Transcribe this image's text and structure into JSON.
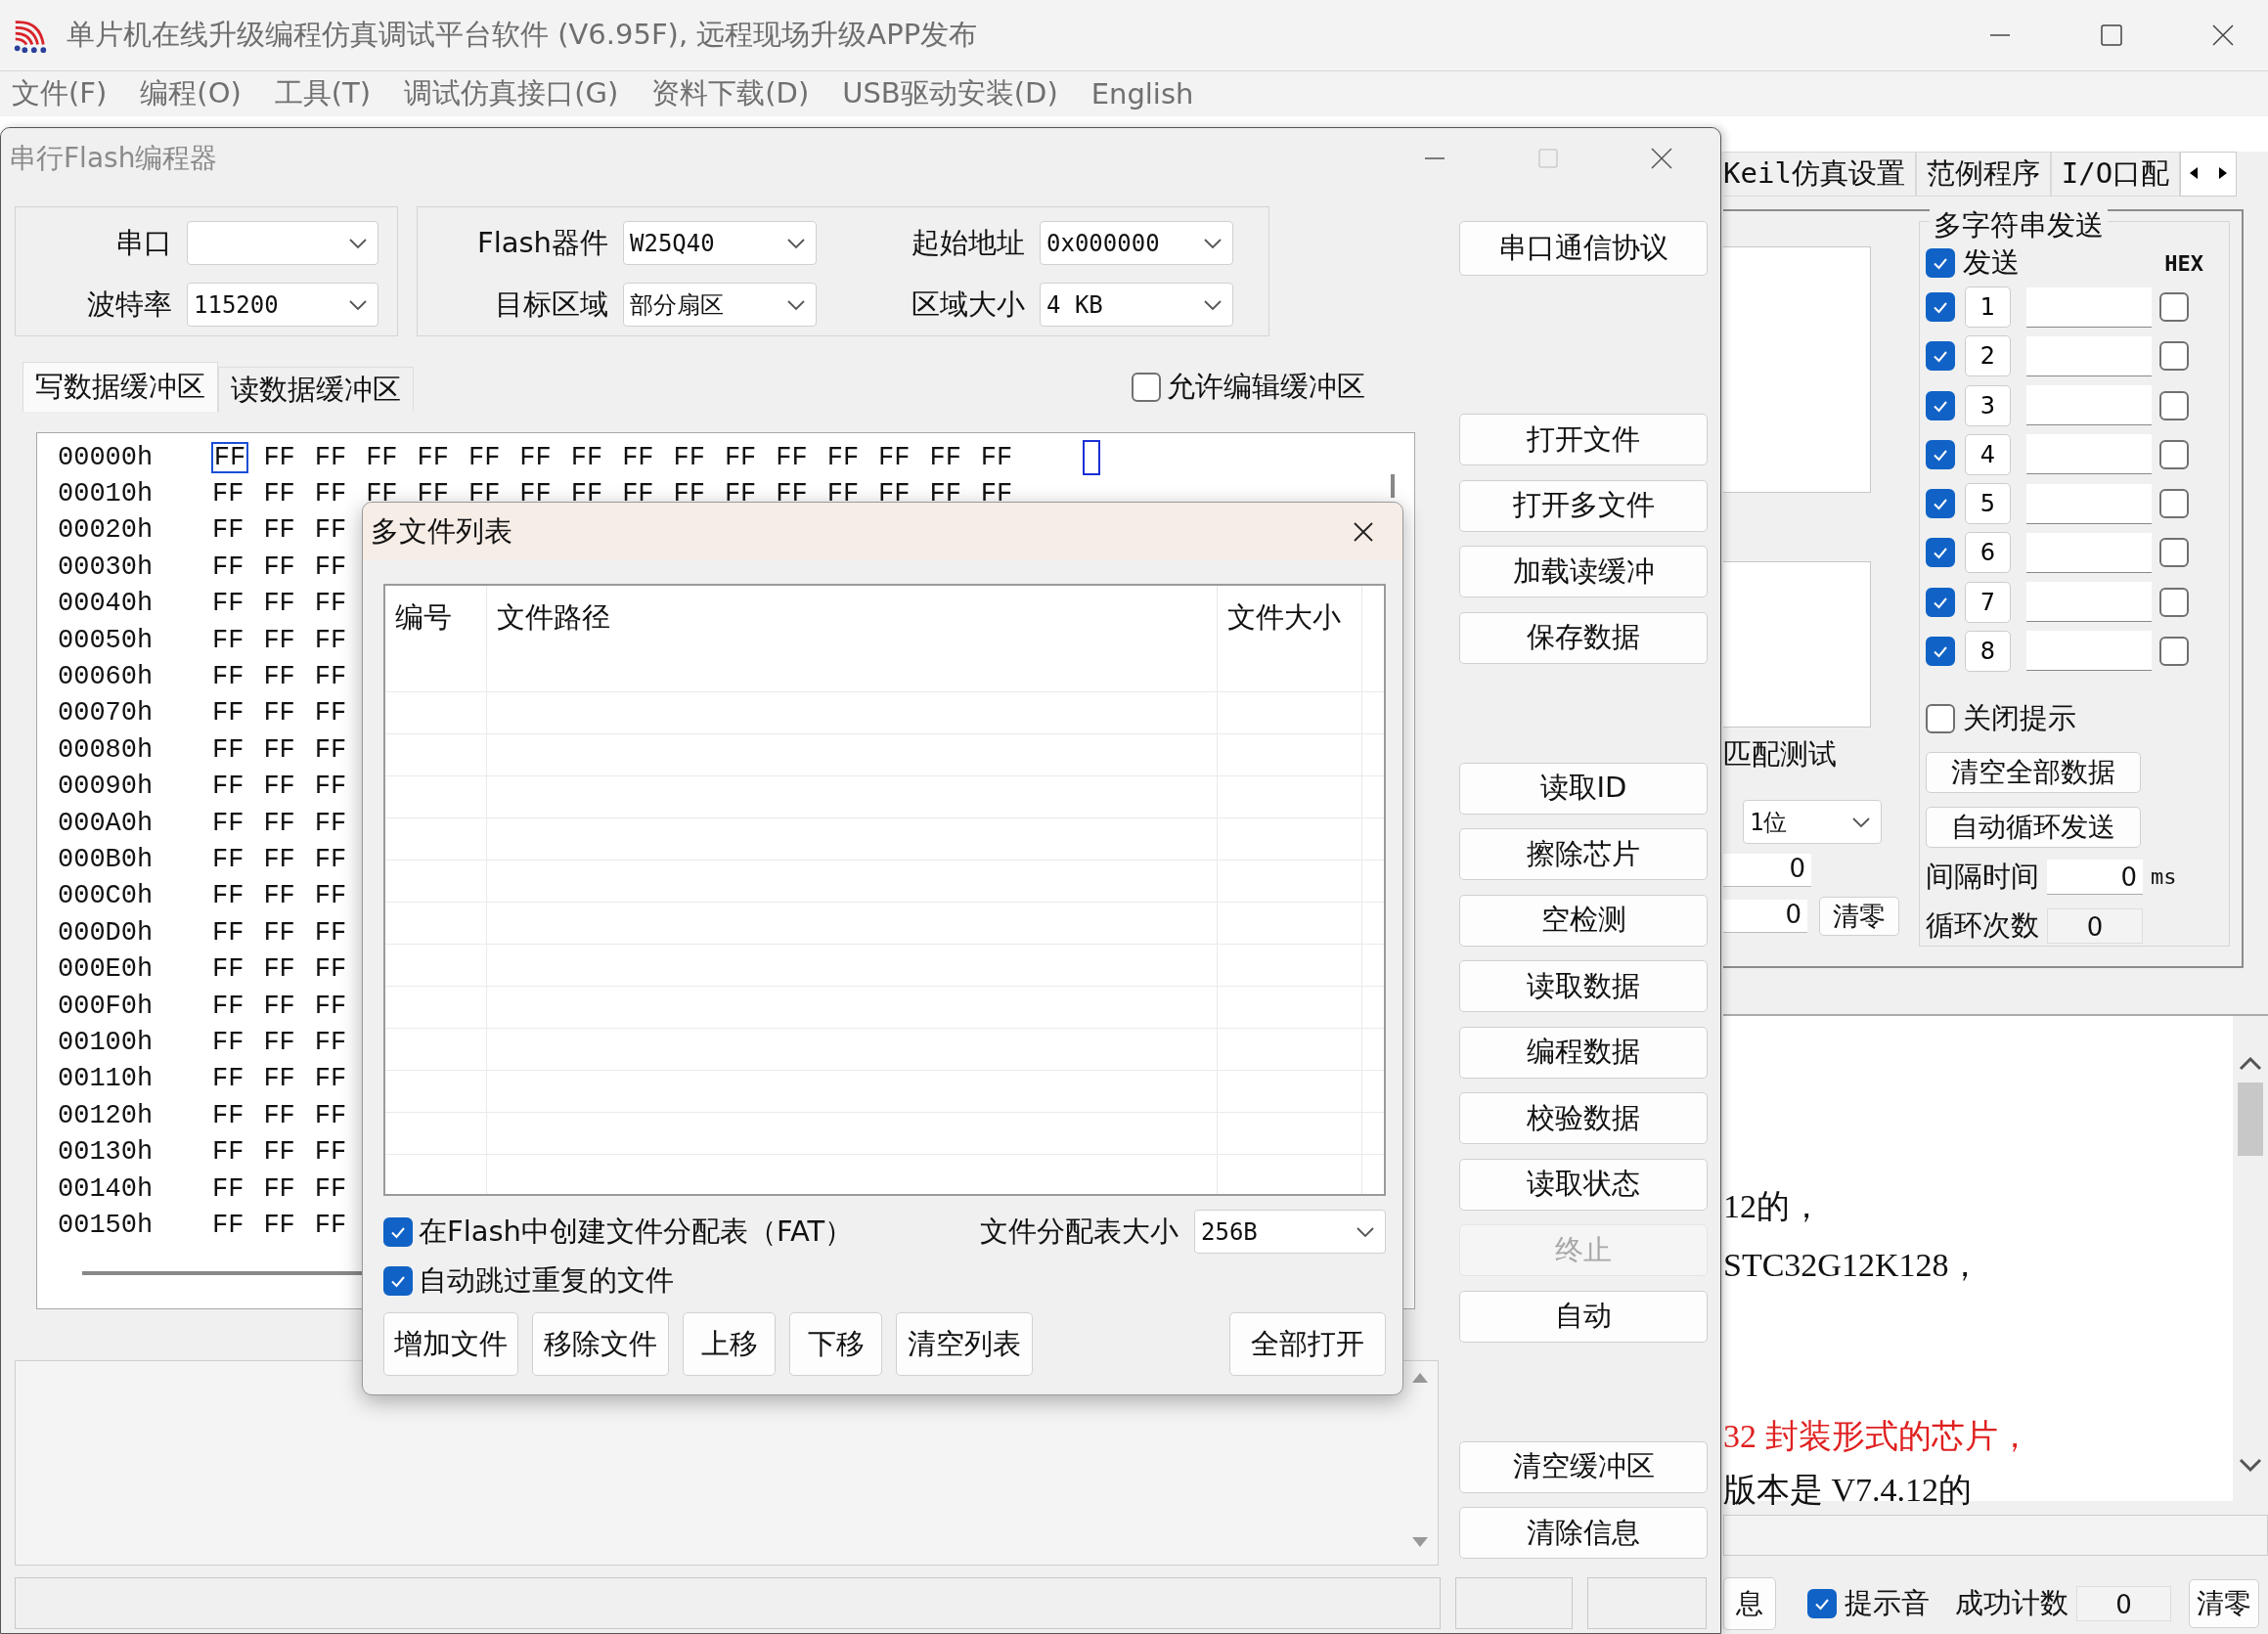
{
  "window": {
    "title": "单片机在线升级编程仿真调试平台软件 (V6.95F), 远程现场升级APP发布"
  },
  "menu": [
    "文件(F)",
    "编程(O)",
    "工具(T)",
    "调试仿真接口(G)",
    "资料下载(D)",
    "USB驱动安装(D)",
    "English"
  ],
  "background_panel": {
    "tabs": [
      {
        "label": "Keil仿真设置",
        "selected": false
      },
      {
        "label": "范例程序",
        "selected": false
      },
      {
        "label": "I/O口配",
        "selected": false
      }
    ],
    "left_column": {
      "caption": "匹配测试",
      "dropdown": "1位",
      "field_1": "0",
      "field_2": "0",
      "clear_button": "清零"
    },
    "multi_send": {
      "title": "多字符串发送",
      "send_all": {
        "label": "发送",
        "checked": true
      },
      "hex_header": "HEX",
      "rows": [
        {
          "number": "1",
          "checked": true,
          "hex": false
        },
        {
          "number": "2",
          "checked": true,
          "hex": false
        },
        {
          "number": "3",
          "checked": true,
          "hex": false
        },
        {
          "number": "4",
          "checked": true,
          "hex": false
        },
        {
          "number": "5",
          "checked": true,
          "hex": false
        },
        {
          "number": "6",
          "checked": true,
          "hex": false
        },
        {
          "number": "7",
          "checked": true,
          "hex": false
        },
        {
          "number": "8",
          "checked": true,
          "hex": false
        }
      ],
      "close_hint": {
        "label": "关闭提示",
        "checked": false
      },
      "buttons": [
        "清空全部数据",
        "自动循环发送"
      ],
      "interval": {
        "label": "间隔时间",
        "value": "0",
        "unit": "ms"
      },
      "loop_count": {
        "label": "循环次数",
        "value": "0"
      }
    },
    "log": [
      {
        "text": "12的，",
        "kind": "normal"
      },
      {
        "text": "STC32G12K128，",
        "kind": "normal"
      },
      {
        "text": "32 封装形式的芯片，",
        "kind": "warning"
      },
      {
        "text": "版本是 V7.4.12的",
        "kind": "normal"
      }
    ],
    "status": {
      "button": "息",
      "beep": {
        "label": "提示音",
        "checked": true
      },
      "success_label": "成功计数",
      "success_value": "0",
      "clear_button": "清零"
    }
  },
  "child_window": {
    "title": "串行Flash编程器",
    "port": {
      "label": "串口"
    },
    "baud": {
      "label": "波特率",
      "value": "115200"
    },
    "flash_device": {
      "label": "Flash器件",
      "value": "W25Q40"
    },
    "start_address": {
      "label": "起始地址",
      "value": "0x000000"
    },
    "target_area": {
      "label": "目标区域",
      "value": "部分扇区"
    },
    "area_size": {
      "label": "区域大小",
      "value": "4 KB"
    },
    "protocol_button": "串口通信协议",
    "tabs": [
      {
        "label": "写数据缓冲区",
        "selected": true
      },
      {
        "label": "读数据缓冲区",
        "selected": false
      }
    ],
    "allow_edit": {
      "label": "允许编辑缓冲区",
      "checked": false
    },
    "hex_rows": [
      {
        "address": "00000h",
        "cursor": true,
        "bytes": [
          "FF",
          "FF",
          "FF",
          "FF",
          "FF",
          "FF",
          "FF",
          "FF",
          "FF",
          "FF",
          "FF",
          "FF",
          "FF",
          "FF",
          "FF",
          "FF"
        ]
      },
      {
        "address": "00010h",
        "cursor": false,
        "bytes": [
          "FF",
          "FF",
          "FF",
          "FF",
          "FF",
          "FF",
          "FF",
          "FF",
          "FF",
          "FF",
          "FF",
          "FF",
          "FF",
          "FF",
          "FF",
          "FF"
        ]
      },
      {
        "address": "00020h",
        "cursor": false,
        "bytes": [
          "FF",
          "FF",
          "FF"
        ]
      },
      {
        "address": "00030h",
        "cursor": false,
        "bytes": [
          "FF",
          "FF",
          "FF"
        ]
      },
      {
        "address": "00040h",
        "cursor": false,
        "bytes": [
          "FF",
          "FF",
          "FF"
        ]
      },
      {
        "address": "00050h",
        "cursor": false,
        "bytes": [
          "FF",
          "FF",
          "FF"
        ]
      },
      {
        "address": "00060h",
        "cursor": false,
        "bytes": [
          "FF",
          "FF",
          "FF"
        ]
      },
      {
        "address": "00070h",
        "cursor": false,
        "bytes": [
          "FF",
          "FF",
          "FF"
        ]
      },
      {
        "address": "00080h",
        "cursor": false,
        "bytes": [
          "FF",
          "FF",
          "FF"
        ]
      },
      {
        "address": "00090h",
        "cursor": false,
        "bytes": [
          "FF",
          "FF",
          "FF"
        ]
      },
      {
        "address": "000A0h",
        "cursor": false,
        "bytes": [
          "FF",
          "FF",
          "FF"
        ]
      },
      {
        "address": "000B0h",
        "cursor": false,
        "bytes": [
          "FF",
          "FF",
          "FF"
        ]
      },
      {
        "address": "000C0h",
        "cursor": false,
        "bytes": [
          "FF",
          "FF",
          "FF"
        ]
      },
      {
        "address": "000D0h",
        "cursor": false,
        "bytes": [
          "FF",
          "FF",
          "FF"
        ]
      },
      {
        "address": "000E0h",
        "cursor": false,
        "bytes": [
          "FF",
          "FF",
          "FF"
        ]
      },
      {
        "address": "000F0h",
        "cursor": false,
        "bytes": [
          "FF",
          "FF",
          "FF"
        ]
      },
      {
        "address": "00100h",
        "cursor": false,
        "bytes": [
          "FF",
          "FF",
          "FF"
        ]
      },
      {
        "address": "00110h",
        "cursor": false,
        "bytes": [
          "FF",
          "FF",
          "FF"
        ]
      },
      {
        "address": "00120h",
        "cursor": false,
        "bytes": [
          "FF",
          "FF",
          "FF"
        ]
      },
      {
        "address": "00130h",
        "cursor": false,
        "bytes": [
          "FF",
          "FF",
          "FF"
        ]
      },
      {
        "address": "00140h",
        "cursor": false,
        "bytes": [
          "FF",
          "FF",
          "FF"
        ]
      },
      {
        "address": "00150h",
        "cursor": false,
        "bytes": [
          "FF",
          "FF",
          "FF"
        ]
      }
    ],
    "button_groups": [
      [
        {
          "label": "打开文件",
          "disabled": false
        },
        {
          "label": "打开多文件",
          "disabled": false
        },
        {
          "label": "加载读缓冲",
          "disabled": false
        },
        {
          "label": "保存数据",
          "disabled": false
        }
      ],
      [
        {
          "label": "读取ID",
          "disabled": false
        },
        {
          "label": "擦除芯片",
          "disabled": false
        },
        {
          "label": "空检测",
          "disabled": false
        },
        {
          "label": "读取数据",
          "disabled": false
        },
        {
          "label": "编程数据",
          "disabled": false
        },
        {
          "label": "校验数据",
          "disabled": false
        },
        {
          "label": "读取状态",
          "disabled": false
        },
        {
          "label": "终止",
          "disabled": true
        },
        {
          "label": "自动",
          "disabled": false
        }
      ],
      [
        {
          "label": "清空缓冲区",
          "disabled": false
        },
        {
          "label": "清除信息",
          "disabled": false
        }
      ]
    ]
  },
  "dialog": {
    "title": "多文件列表",
    "columns": [
      "编号",
      "文件路径",
      "文件大小"
    ],
    "create_fat": {
      "label": "在Flash中创建文件分配表（FAT）",
      "checked": true
    },
    "fat_size": {
      "label": "文件分配表大小",
      "value": "256B"
    },
    "skip_duplicates": {
      "label": "自动跳过重复的文件",
      "checked": true
    },
    "buttons": [
      "增加文件",
      "移除文件",
      "上移",
      "下移",
      "清空列表"
    ],
    "open_all_button": "全部打开"
  }
}
